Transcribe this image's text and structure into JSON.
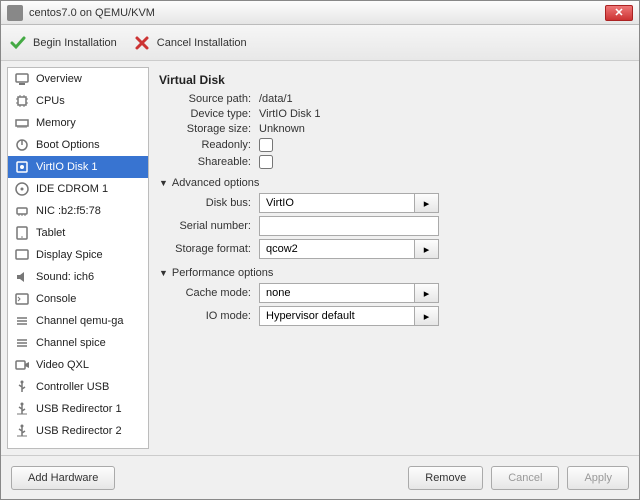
{
  "window": {
    "title": "centos7.0 on QEMU/KVM"
  },
  "toolbar": {
    "begin": "Begin Installation",
    "cancel": "Cancel Installation"
  },
  "sidebar": {
    "items": [
      {
        "label": "Overview",
        "icon": "monitor"
      },
      {
        "label": "CPUs",
        "icon": "cpu"
      },
      {
        "label": "Memory",
        "icon": "memory"
      },
      {
        "label": "Boot Options",
        "icon": "boot"
      },
      {
        "label": "VirtIO Disk 1",
        "icon": "disk",
        "selected": true
      },
      {
        "label": "IDE CDROM 1",
        "icon": "cdrom"
      },
      {
        "label": "NIC :b2:f5:78",
        "icon": "nic"
      },
      {
        "label": "Tablet",
        "icon": "tablet"
      },
      {
        "label": "Display Spice",
        "icon": "display"
      },
      {
        "label": "Sound: ich6",
        "icon": "sound"
      },
      {
        "label": "Console",
        "icon": "console"
      },
      {
        "label": "Channel qemu-ga",
        "icon": "channel"
      },
      {
        "label": "Channel spice",
        "icon": "channel"
      },
      {
        "label": "Video QXL",
        "icon": "video"
      },
      {
        "label": "Controller USB",
        "icon": "usb"
      },
      {
        "label": "USB Redirector 1",
        "icon": "usbredir"
      },
      {
        "label": "USB Redirector 2",
        "icon": "usbredir"
      }
    ]
  },
  "details": {
    "heading": "Virtual Disk",
    "source_path_label": "Source path:",
    "source_path": "/data/1",
    "device_type_label": "Device type:",
    "device_type": "VirtIO Disk 1",
    "storage_size_label": "Storage size:",
    "storage_size": "Unknown",
    "readonly_label": "Readonly:",
    "readonly": false,
    "shareable_label": "Shareable:",
    "shareable": false,
    "advanced_label": "Advanced options",
    "disk_bus_label": "Disk bus:",
    "disk_bus": "VirtIO",
    "serial_label": "Serial number:",
    "serial": "",
    "storage_format_label": "Storage format:",
    "storage_format": "qcow2",
    "perf_label": "Performance options",
    "cache_mode_label": "Cache mode:",
    "cache_mode": "none",
    "io_mode_label": "IO mode:",
    "io_mode": "Hypervisor default"
  },
  "footer": {
    "add_hardware": "Add Hardware",
    "remove": "Remove",
    "cancel": "Cancel",
    "apply": "Apply"
  }
}
